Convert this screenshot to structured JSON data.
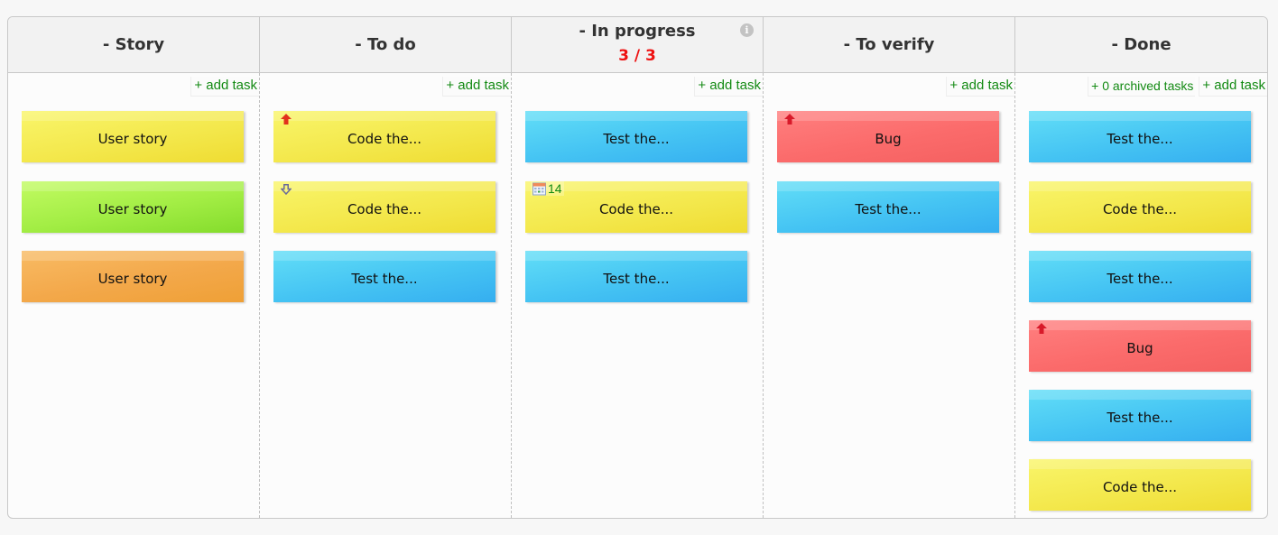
{
  "board": {
    "columns": [
      {
        "title": "- Story",
        "actions": [
          {
            "label": "+ add task"
          }
        ],
        "cards": [
          {
            "title": "User story",
            "color": "yellow"
          },
          {
            "title": "User story",
            "color": "green"
          },
          {
            "title": "User story",
            "color": "orange"
          }
        ]
      },
      {
        "title": "- To do",
        "actions": [
          {
            "label": "+ add task"
          }
        ],
        "cards": [
          {
            "title": "Code the...",
            "color": "yellow",
            "priority": "high-priority-arrow-up"
          },
          {
            "title": "Code the...",
            "color": "yellow",
            "priority": "low-priority-arrow-down"
          },
          {
            "title": "Test the...",
            "color": "blue"
          }
        ]
      },
      {
        "title": "- In progress",
        "wip_limit": "3 / 3",
        "info_icon": "i",
        "actions": [
          {
            "label": "+ add task"
          }
        ],
        "cards": [
          {
            "title": "Test the...",
            "color": "blue"
          },
          {
            "title": "Code the...",
            "color": "yellow",
            "due_day": "14"
          },
          {
            "title": "Test the...",
            "color": "blue"
          }
        ]
      },
      {
        "title": "- To verify",
        "actions": [
          {
            "label": "+ add task"
          }
        ],
        "cards": [
          {
            "title": "Bug",
            "color": "red",
            "priority": "high-priority-arrow-up"
          },
          {
            "title": "Test the...",
            "color": "blue"
          }
        ]
      },
      {
        "title": "- Done",
        "actions": [
          {
            "label": "+ 0 archived tasks"
          },
          {
            "label": "+ add task"
          }
        ],
        "cards": [
          {
            "title": "Test the...",
            "color": "blue"
          },
          {
            "title": "Code the...",
            "color": "yellow"
          },
          {
            "title": "Test the...",
            "color": "blue"
          },
          {
            "title": "Bug",
            "color": "red",
            "priority": "high-priority-arrow-up"
          },
          {
            "title": "Test the...",
            "color": "blue"
          },
          {
            "title": "Code the...",
            "color": "yellow"
          }
        ]
      }
    ]
  },
  "colors": {
    "yellow": "#f3e74a",
    "blue": "#45c4f3",
    "green": "#a2ed44",
    "orange": "#f3a84a",
    "red": "#fb6b6b",
    "wip_text": "#ee1111",
    "link_text": "#138a13"
  }
}
